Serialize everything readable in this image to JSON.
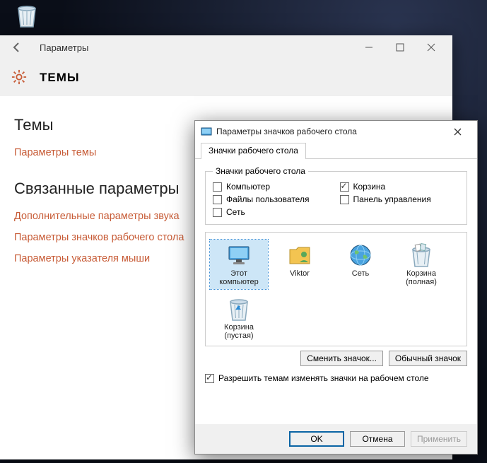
{
  "desktop_icon_label": "",
  "settings": {
    "window_title": "Параметры",
    "header_title": "ТЕМЫ",
    "section1": "Темы",
    "link_theme_params": "Параметры темы",
    "section2": "Связанные параметры",
    "links": [
      "Дополнительные параметры звука",
      "Параметры значков рабочего стола",
      "Параметры указателя мыши"
    ]
  },
  "dialog": {
    "title": "Параметры значков рабочего стола",
    "tab": "Значки рабочего стола",
    "group_legend": "Значки рабочего стола",
    "checkboxes": {
      "computer": "Компьютер",
      "recycle": "Корзина",
      "user_files": "Файлы пользователя",
      "control_panel": "Панель управления",
      "network": "Сеть"
    },
    "checked": {
      "recycle": true
    },
    "icons": [
      {
        "id": "this-computer",
        "label": "Этот компьютер",
        "kind": "monitor"
      },
      {
        "id": "viktor",
        "label": "Viktor",
        "kind": "folder-user"
      },
      {
        "id": "network",
        "label": "Сеть",
        "kind": "globe"
      },
      {
        "id": "recycle-full",
        "label": "Корзина (полная)",
        "kind": "bin-full"
      },
      {
        "id": "recycle-empty",
        "label": "Корзина (пустая)",
        "kind": "bin-empty"
      }
    ],
    "selected_icon": "this-computer",
    "btn_change": "Сменить значок...",
    "btn_default": "Обычный значок",
    "allow_label": "Разрешить темам изменять значки на рабочем столе",
    "allow_checked": true,
    "footer": {
      "ok": "OK",
      "cancel": "Отмена",
      "apply": "Применить"
    }
  }
}
